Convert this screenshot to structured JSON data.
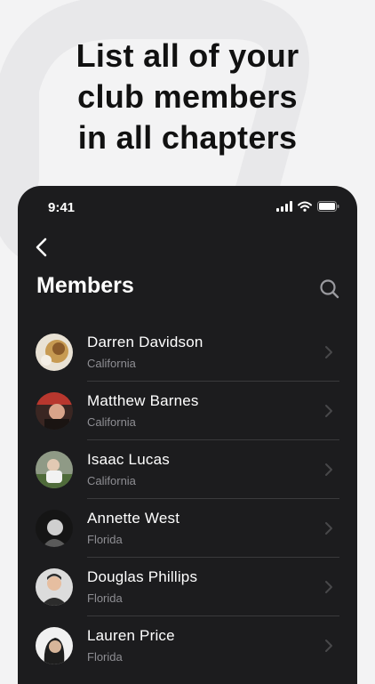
{
  "headline": {
    "line1": "List all of your",
    "line2": "club members",
    "line3": "in all chapters"
  },
  "status_bar": {
    "time": "9:41"
  },
  "screen": {
    "title": "Members"
  },
  "icons": {
    "back": "chevron-left-icon",
    "search": "search-icon",
    "row": "chevron-right-icon"
  },
  "members": [
    {
      "name": "Darren Davidson",
      "location": "California"
    },
    {
      "name": "Matthew Barnes",
      "location": "California"
    },
    {
      "name": "Isaac Lucas",
      "location": "California"
    },
    {
      "name": "Annette West",
      "location": "Florida"
    },
    {
      "name": "Douglas Phillips",
      "location": "Florida"
    },
    {
      "name": "Lauren Price",
      "location": "Florida"
    }
  ],
  "colors": {
    "page_bg": "#f3f3f4",
    "phone_bg": "#1c1c1e",
    "secondary_text": "#8e8e93",
    "divider": "#3a3a3c"
  }
}
